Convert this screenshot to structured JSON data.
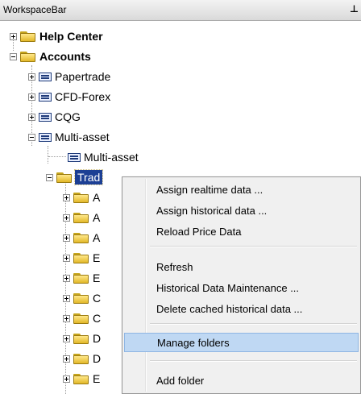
{
  "window": {
    "title": "WorkspaceBar",
    "pin_glyph": "Ѧ"
  },
  "tree": {
    "help_center": "Help Center",
    "accounts": "Accounts",
    "papertrade": "Papertrade",
    "cfd_forex": "CFD-Forex",
    "cqg": "CQG",
    "multi_asset": "Multi-asset",
    "multi_asset_child": "Multi-asset",
    "trade_partial": "Trad",
    "partial_folders": [
      "A",
      "A",
      "A",
      "E",
      "E",
      "C",
      "C",
      "D",
      "D",
      "E"
    ]
  },
  "context_menu": {
    "items": [
      "Assign realtime data ...",
      "Assign historical data ...",
      "Reload Price Data",
      "Refresh",
      "Historical Data Maintenance ...",
      "Delete cached historical data ...",
      "Manage folders",
      "Add folder"
    ],
    "highlighted": "Manage folders"
  },
  "colors": {
    "selection": "#1c3f94",
    "menu_highlight": "#bfd8f3",
    "folder": "#f0cc45"
  }
}
